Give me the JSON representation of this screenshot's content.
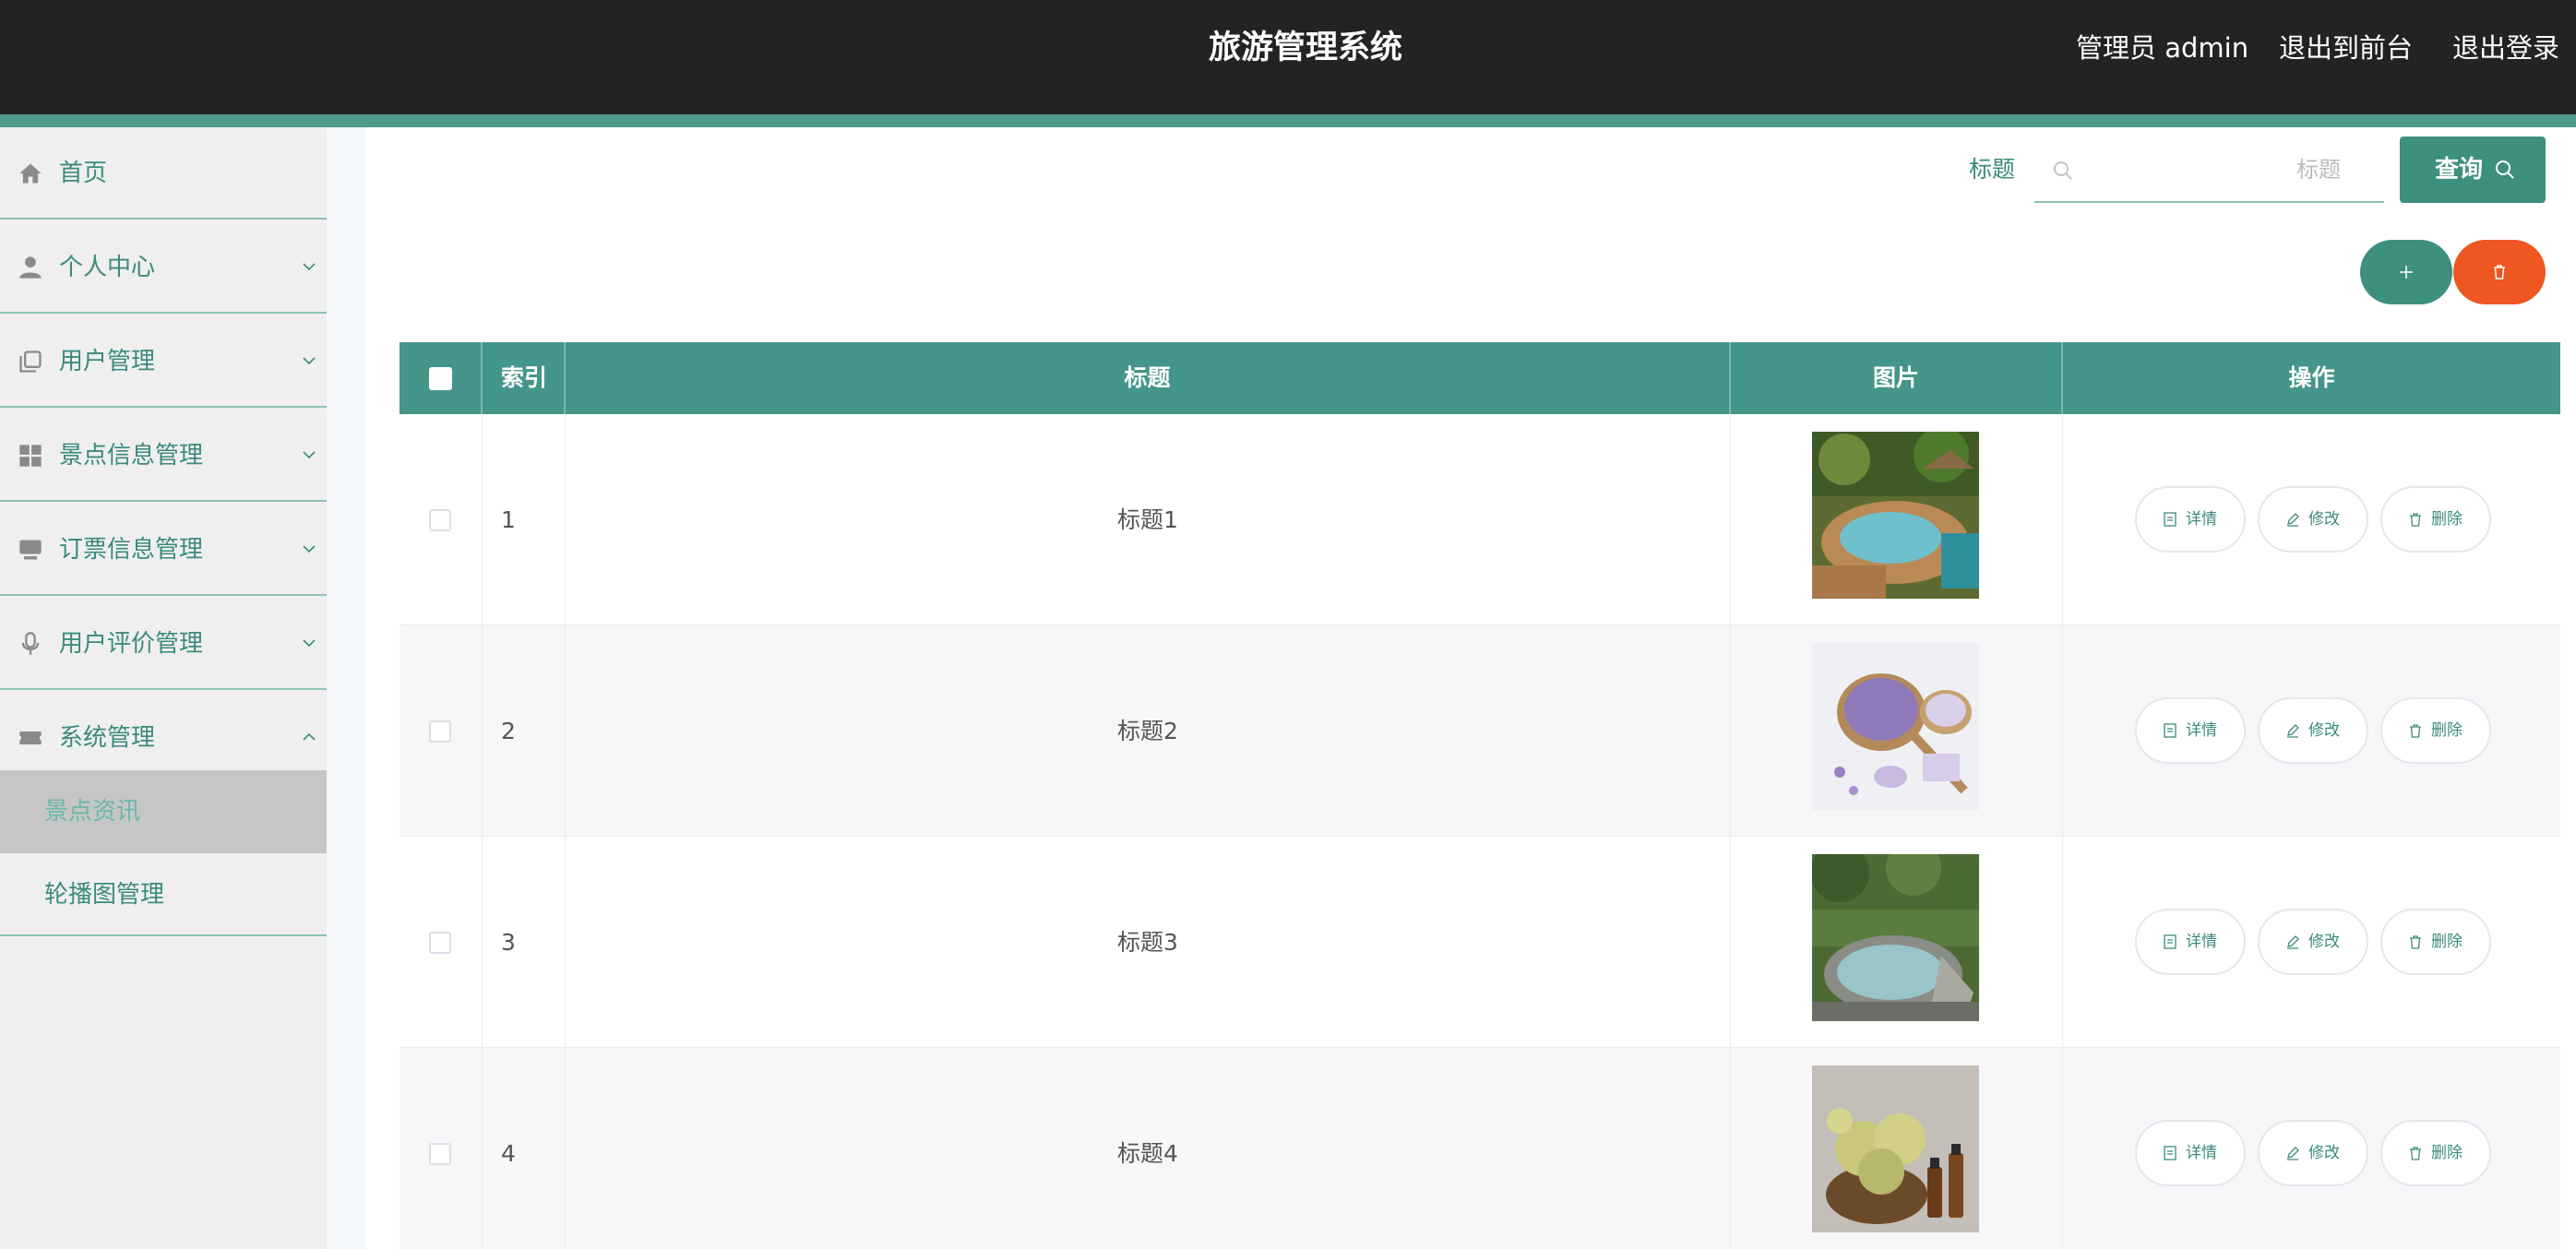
{
  "header": {
    "title": "旅游管理系统",
    "user": "管理员 admin",
    "to_front": "退出到前台",
    "logout": "退出登录"
  },
  "sidebar": {
    "items": [
      {
        "label": "首页",
        "icon": "home-icon"
      },
      {
        "label": "个人中心",
        "icon": "user-icon"
      },
      {
        "label": "用户管理",
        "icon": "copy-icon"
      },
      {
        "label": "景点信息管理",
        "icon": "grid-icon"
      },
      {
        "label": "订票信息管理",
        "icon": "monitor-icon"
      },
      {
        "label": "用户评价管理",
        "icon": "microphone-icon"
      },
      {
        "label": "系统管理",
        "icon": "ticket-icon"
      }
    ],
    "sub_items": [
      {
        "label": "景点资讯",
        "active": true
      },
      {
        "label": "轮播图管理",
        "active": false
      }
    ]
  },
  "search": {
    "label": "标题",
    "placeholder": "标题",
    "value": "",
    "button": "查询"
  },
  "table": {
    "columns": [
      "索引",
      "标题",
      "图片",
      "操作"
    ],
    "rows": [
      {
        "index": "1",
        "title": "标题1",
        "image": "pool-garden-photo"
      },
      {
        "index": "2",
        "title": "标题2",
        "image": "lavender-salt-photo"
      },
      {
        "index": "3",
        "title": "标题3",
        "image": "outdoor-pool-photo"
      },
      {
        "index": "4",
        "title": "标题4",
        "image": "flowers-oil-photo"
      }
    ],
    "actions": {
      "detail": "详情",
      "edit": "修改",
      "delete": "删除"
    }
  },
  "colors": {
    "header_bg": "#232323",
    "accent": "#3d8f80",
    "table_header": "#44958a",
    "danger": "#ee5622",
    "sidebar_bg": "#efefef"
  }
}
